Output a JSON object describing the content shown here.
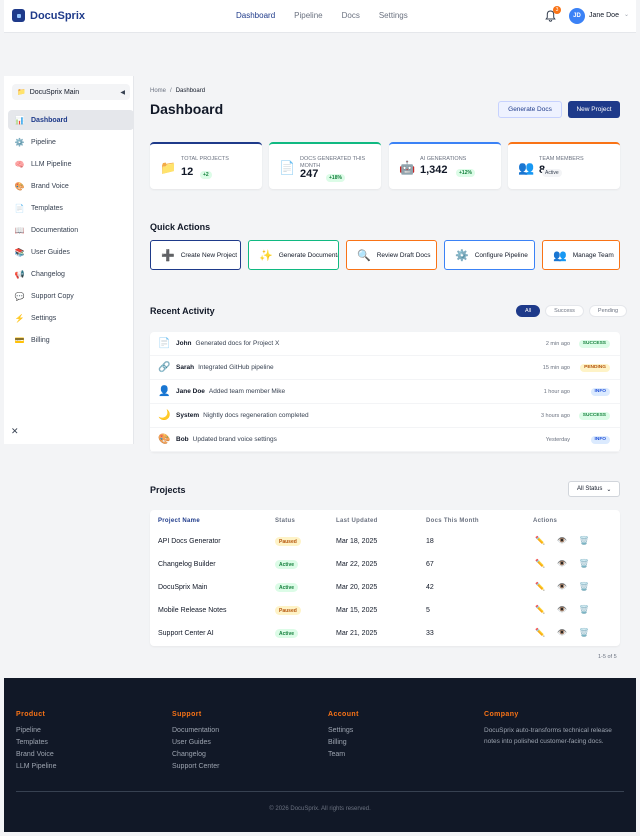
{
  "header": {
    "logo": "DocuSprix",
    "nav": [
      "Dashboard",
      "Pipeline",
      "Docs",
      "Settings"
    ],
    "notifications": "3",
    "user_initials": "JD",
    "user_name": "Jane Doe"
  },
  "sidebar": {
    "workspace": "DocuSprix Main",
    "items": [
      {
        "label": "Dashboard",
        "icon": "chart-icon",
        "glyph": "📊"
      },
      {
        "label": "Pipeline",
        "icon": "gear-icon",
        "glyph": "⚙️"
      },
      {
        "label": "LLM Pipeline",
        "icon": "brain-icon",
        "glyph": "🧠"
      },
      {
        "label": "Brand Voice",
        "icon": "palette-icon",
        "glyph": "🎨"
      },
      {
        "label": "Templates",
        "icon": "page-icon",
        "glyph": "📄"
      },
      {
        "label": "Documentation",
        "icon": "book-icon",
        "glyph": "📖"
      },
      {
        "label": "User Guides",
        "icon": "books-icon",
        "glyph": "📚"
      },
      {
        "label": "Changelog",
        "icon": "megaphone-icon",
        "glyph": "📢"
      },
      {
        "label": "Support Copy",
        "icon": "speech-bubble-icon",
        "glyph": "💬"
      },
      {
        "label": "Settings",
        "icon": "lightning-icon",
        "glyph": "⚡"
      },
      {
        "label": "Billing",
        "icon": "credit-card-icon",
        "glyph": "💳"
      }
    ]
  },
  "breadcrumb": {
    "home": "Home",
    "sep": "/",
    "current": "Dashboard"
  },
  "page": {
    "title": "Dashboard",
    "generate_label": "Generate Docs",
    "new_project_label": "New Project"
  },
  "stats": [
    {
      "label": "Total Projects",
      "value": "12",
      "badge": "+2",
      "icon": "folder-icon",
      "glyph": "📁",
      "color": "#1e3a8a"
    },
    {
      "label": "Docs Generated This Month",
      "value": "247",
      "badge": "+18%",
      "icon": "document-icon",
      "glyph": "📄",
      "color": "#10b981"
    },
    {
      "label": "AI Generations",
      "value": "1,342",
      "badge": "+12%",
      "icon": "robot-icon",
      "glyph": "🤖",
      "color": "#3b82f6"
    },
    {
      "label": "Team Members",
      "value": "8",
      "badge": "Active",
      "icon": "team-icon",
      "glyph": "👥",
      "color": "#f97316"
    }
  ],
  "quick_actions": {
    "title": "Quick Actions",
    "items": [
      {
        "label": "Create New Project",
        "icon": "plus-icon",
        "glyph": "➕",
        "color": "#1e3a8a"
      },
      {
        "label": "Generate Documentation",
        "icon": "sparkles-icon",
        "glyph": "✨",
        "color": "#10b981"
      },
      {
        "label": "Review Draft Docs",
        "icon": "magnifier-icon",
        "glyph": "🔍",
        "color": "#f97316"
      },
      {
        "label": "Configure Pipeline",
        "icon": "gear-icon",
        "glyph": "⚙️",
        "color": "#3b82f6"
      },
      {
        "label": "Manage Team",
        "icon": "team-icon",
        "glyph": "👥",
        "color": "#f97316"
      }
    ]
  },
  "activity": {
    "title": "Recent Activity",
    "filters": [
      "All",
      "Success",
      "Pending"
    ],
    "items": [
      {
        "who": "John",
        "what": "Generated docs for Project X",
        "when": "2 min ago",
        "status": "Success",
        "icon": "document-icon",
        "glyph": "📄"
      },
      {
        "who": "Sarah",
        "what": "Integrated GitHub pipeline",
        "when": "15 min ago",
        "status": "Pending",
        "icon": "link-icon",
        "glyph": "🔗"
      },
      {
        "who": "Jane Doe",
        "what": "Added team member Mike",
        "when": "1 hour ago",
        "status": "Info",
        "icon": "user-icon",
        "glyph": "👤"
      },
      {
        "who": "System",
        "what": "Nightly docs regeneration completed",
        "when": "3 hours ago",
        "status": "Success",
        "icon": "moon-icon",
        "glyph": "🌙"
      },
      {
        "who": "Bob",
        "what": "Updated brand voice settings",
        "when": "Yesterday",
        "status": "Info",
        "icon": "palette-icon",
        "glyph": "🎨"
      }
    ]
  },
  "projects": {
    "title": "Projects",
    "filter": "All Status",
    "columns": [
      "Project Name",
      "Status",
      "Last Updated",
      "Docs This Month",
      "Actions"
    ],
    "rows": [
      {
        "name": "API Docs Generator",
        "status": "Paused",
        "updated": "Mar 18, 2025",
        "docs": "18"
      },
      {
        "name": "Changelog Builder",
        "status": "Active",
        "updated": "Mar 22, 2025",
        "docs": "67"
      },
      {
        "name": "DocuSprix Main",
        "status": "Active",
        "updated": "Mar 20, 2025",
        "docs": "42"
      },
      {
        "name": "Mobile Release Notes",
        "status": "Paused",
        "updated": "Mar 15, 2025",
        "docs": "5"
      },
      {
        "name": "Support Center AI",
        "status": "Active",
        "updated": "Mar 21, 2025",
        "docs": "33"
      }
    ],
    "pagination": "1-5 of 5"
  },
  "footer": {
    "columns": [
      {
        "title": "Product",
        "links": [
          "Pipeline",
          "Templates",
          "Brand Voice",
          "LLM Pipeline"
        ]
      },
      {
        "title": "Support",
        "links": [
          "Documentation",
          "User Guides",
          "Changelog",
          "Support Center"
        ]
      },
      {
        "title": "Account",
        "links": [
          "Settings",
          "Billing",
          "Team"
        ]
      }
    ],
    "company_title": "Company",
    "company_desc": "DocuSprix auto-transforms technical release notes into polished customer-facing docs.",
    "copyright": "© 2026 DocuSprix. All rights reserved."
  },
  "colors": {
    "primary": "#1e3a8a",
    "accent": "#f97316",
    "success": "#10b981",
    "info": "#3b82f6"
  }
}
